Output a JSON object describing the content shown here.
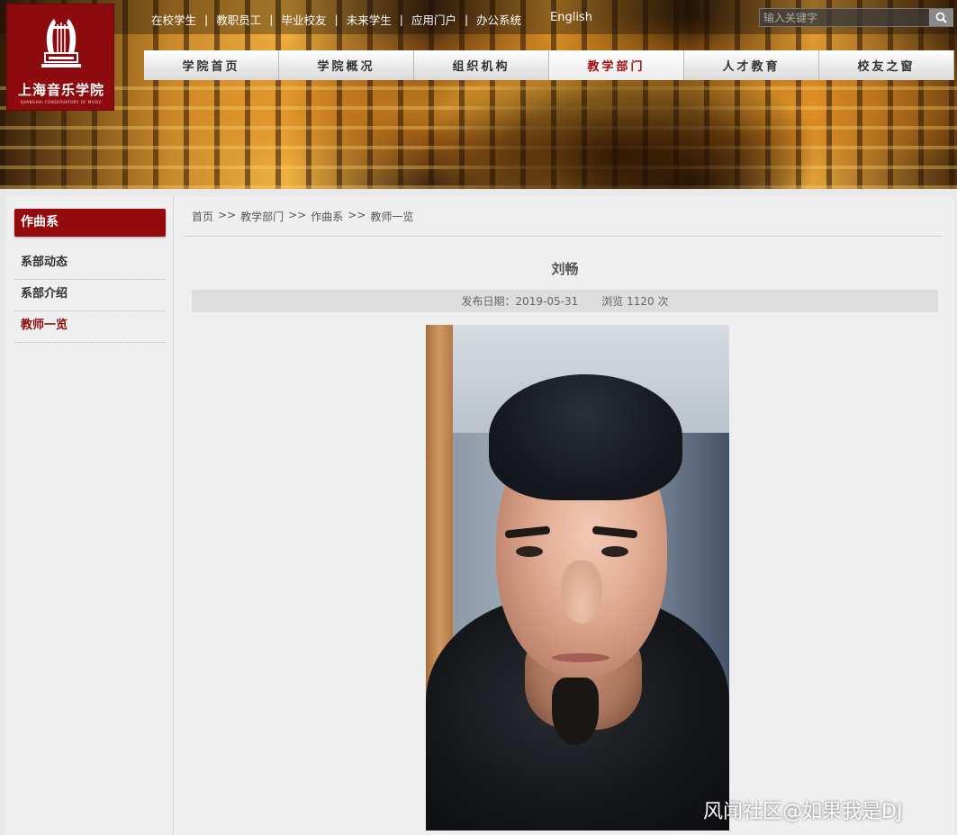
{
  "header": {
    "logo": {
      "name_cn": "上海音乐学院",
      "name_en": "SHANGHAI CONSERVATORY OF MUSIC"
    },
    "quicklinks": [
      "在校学生",
      "教职员工",
      "毕业校友",
      "未来学生",
      "应用门户",
      "办公系统"
    ],
    "quicklink_separator": "|",
    "english_link": "English",
    "search": {
      "placeholder": "输入关键字",
      "icon": "search-icon"
    },
    "main_nav": [
      {
        "label": "学院首页",
        "active": false
      },
      {
        "label": "学院概况",
        "active": false
      },
      {
        "label": "组织机构",
        "active": false
      },
      {
        "label": "教学部门",
        "active": true
      },
      {
        "label": "人才教育",
        "active": false
      },
      {
        "label": "校友之窗",
        "active": false
      }
    ]
  },
  "sidebar": {
    "title": "作曲系",
    "items": [
      {
        "label": "系部动态",
        "active": false
      },
      {
        "label": "系部介绍",
        "active": false
      },
      {
        "label": "教师一览",
        "active": true
      }
    ]
  },
  "breadcrumb": {
    "separator": ">>",
    "items": [
      "首页",
      "教学部门",
      "作曲系",
      "教师一览"
    ]
  },
  "article": {
    "title": "刘畅",
    "publish_date": "发布日期：2019-05-31",
    "views": "浏览 1120 次"
  },
  "watermark": "风闻社区@如果我是DJ",
  "colors": {
    "brand_red": "#950a0d",
    "active_text": "#8d0b0e"
  }
}
